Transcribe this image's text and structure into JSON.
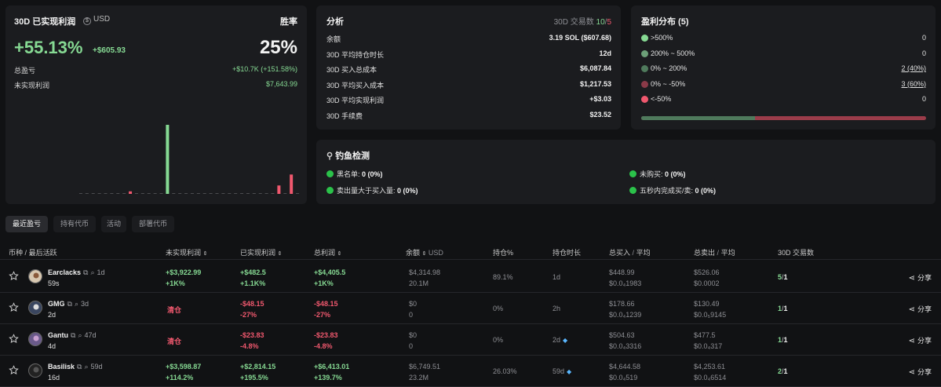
{
  "pnl_card": {
    "title": "30D 已实现利润",
    "currency": "USD",
    "currency_icon": "dollar-circle-icon",
    "winrate_label": "胜率",
    "pnl_percent": "+55.13%",
    "pnl_usd": "+$605.93",
    "winrate": "25%",
    "total_label": "总盈亏",
    "total_value": "+$10.7K (+151.58%)",
    "unrealized_label": "未实现利润",
    "unrealized_value": "$7,643.99"
  },
  "chart_data": {
    "type": "bar",
    "values": [
      0,
      0,
      0,
      0,
      0,
      0,
      0,
      0,
      -0.3,
      0,
      0,
      0,
      0,
      0,
      8.2,
      0,
      0,
      0,
      0,
      0,
      0,
      0,
      0,
      0,
      0,
      0,
      0,
      0,
      0,
      0,
      0,
      0,
      -1,
      0,
      -2.3,
      0
    ],
    "colors": {
      "positive": "#86d993",
      "negative": "#f0586e"
    }
  },
  "analysis": {
    "title": "分析",
    "trades_label": "30D 交易数",
    "trades_win": "10",
    "trades_sep": "/",
    "trades_loss": "5",
    "rows": [
      {
        "label": "余额",
        "value": "3.19 SOL ($607.68)"
      },
      {
        "label": "30D 平均持仓时长",
        "value": "12d"
      },
      {
        "label": "30D 买入总成本",
        "value": "$6,087.84"
      },
      {
        "label": "30D 平均买入成本",
        "value": "$1,217.53"
      },
      {
        "label": "30D 平均实现利润",
        "value": "+$3.03"
      },
      {
        "label": "30D 手续费",
        "value": "$23.52"
      }
    ]
  },
  "distribution": {
    "title": "盈利分布 (5)",
    "rows": [
      {
        "label": ">500%",
        "value": "0",
        "color": "#86d993"
      },
      {
        "label": "200% ~ 500%",
        "value": "0",
        "color": "#6c9f78"
      },
      {
        "label": "0% ~ 200%",
        "value": "2 (40%)",
        "color": "#4f7a5c"
      },
      {
        "label": "0% ~ -50%",
        "value": "3 (60%)",
        "color": "#8a3a48"
      },
      {
        "label": "<-50%",
        "value": "0",
        "color": "#f0586e"
      }
    ],
    "positive_ratio": 0.4
  },
  "phishing": {
    "title": "钓鱼检测",
    "title_icon": "fish-hook-icon",
    "items": [
      {
        "label": "黑名单:",
        "value": "0 (0%)"
      },
      {
        "label": "未购买:",
        "value": "0 (0%)"
      },
      {
        "label": "卖出量大于买入量:",
        "value": "0 (0%)"
      },
      {
        "label": "五秒内完成买/卖:",
        "value": "0 (0%)"
      }
    ]
  },
  "tabs": [
    "最近盈亏",
    "持有代币",
    "活动",
    "部署代币"
  ],
  "table": {
    "headers": {
      "coin": "币种",
      "sep": "/",
      "last_active": "最后活跃",
      "unrealized": "未实现利润",
      "realized": "已实现利润",
      "total": "总利润",
      "balance": "余额",
      "balance_unit": "USD",
      "position": "持仓%",
      "hold": "持仓时长",
      "bought": "总买入",
      "bought_avg": "平均",
      "sold": "总卖出",
      "sold_avg": "平均",
      "trades": "30D 交易数"
    },
    "rows": [
      {
        "name": "Earclacks",
        "age": "1d",
        "active": "59s",
        "unreal1": "+$3,922.99",
        "unreal2": "+1K%",
        "real1": "+$482.5",
        "real2": "+1.1K%",
        "tot1": "+$4,405.5",
        "tot2": "+1K%",
        "bal1": "$4,314.98",
        "bal2": "20.1M",
        "pos": "89.1%",
        "hold": "1d",
        "hold_gem": false,
        "buy1": "$448.99",
        "buy2": "$0.0₄1983",
        "sell1": "$526.06",
        "sell2": "$0.0002",
        "tw": "5",
        "tl": "1",
        "share": "分享",
        "tone": "green"
      },
      {
        "name": "GMG",
        "age": "3d",
        "active": "2d",
        "unreal1": "清仓",
        "unreal2": "",
        "real1": "-$48.15",
        "real2": "-27%",
        "tot1": "-$48.15",
        "tot2": "-27%",
        "bal1": "$0",
        "bal2": "0",
        "pos": "0%",
        "hold": "2h",
        "hold_gem": false,
        "buy1": "$178.66",
        "buy2": "$0.0₄1239",
        "sell1": "$130.49",
        "sell2": "$0.0₅9145",
        "tw": "1",
        "tl": "1",
        "share": "分享",
        "tone": "red"
      },
      {
        "name": "Gantu",
        "age": "47d",
        "active": "4d",
        "unreal1": "清仓",
        "unreal2": "",
        "real1": "-$23.83",
        "real2": "-4.8%",
        "tot1": "-$23.83",
        "tot2": "-4.8%",
        "bal1": "$0",
        "bal2": "0",
        "pos": "0%",
        "hold": "2d",
        "hold_gem": true,
        "buy1": "$504.63",
        "buy2": "$0.0₄3316",
        "sell1": "$477.5",
        "sell2": "$0.0₄317",
        "tw": "1",
        "tl": "1",
        "share": "分享",
        "tone": "red"
      },
      {
        "name": "Basilisk",
        "age": "59d",
        "active": "16d",
        "unreal1": "+$3,598.87",
        "unreal2": "+114.2%",
        "real1": "+$2,814.15",
        "real2": "+195.5%",
        "tot1": "+$6,413.01",
        "tot2": "+139.7%",
        "bal1": "$6,749.51",
        "bal2": "23.2M",
        "pos": "26.03%",
        "hold": "59d",
        "hold_gem": true,
        "buy1": "$4,644.58",
        "buy2": "$0.0₄519",
        "sell1": "$4,253.61",
        "sell2": "$0.0₄6514",
        "tw": "2",
        "tl": "1",
        "share": "分享",
        "tone": "green"
      }
    ]
  }
}
